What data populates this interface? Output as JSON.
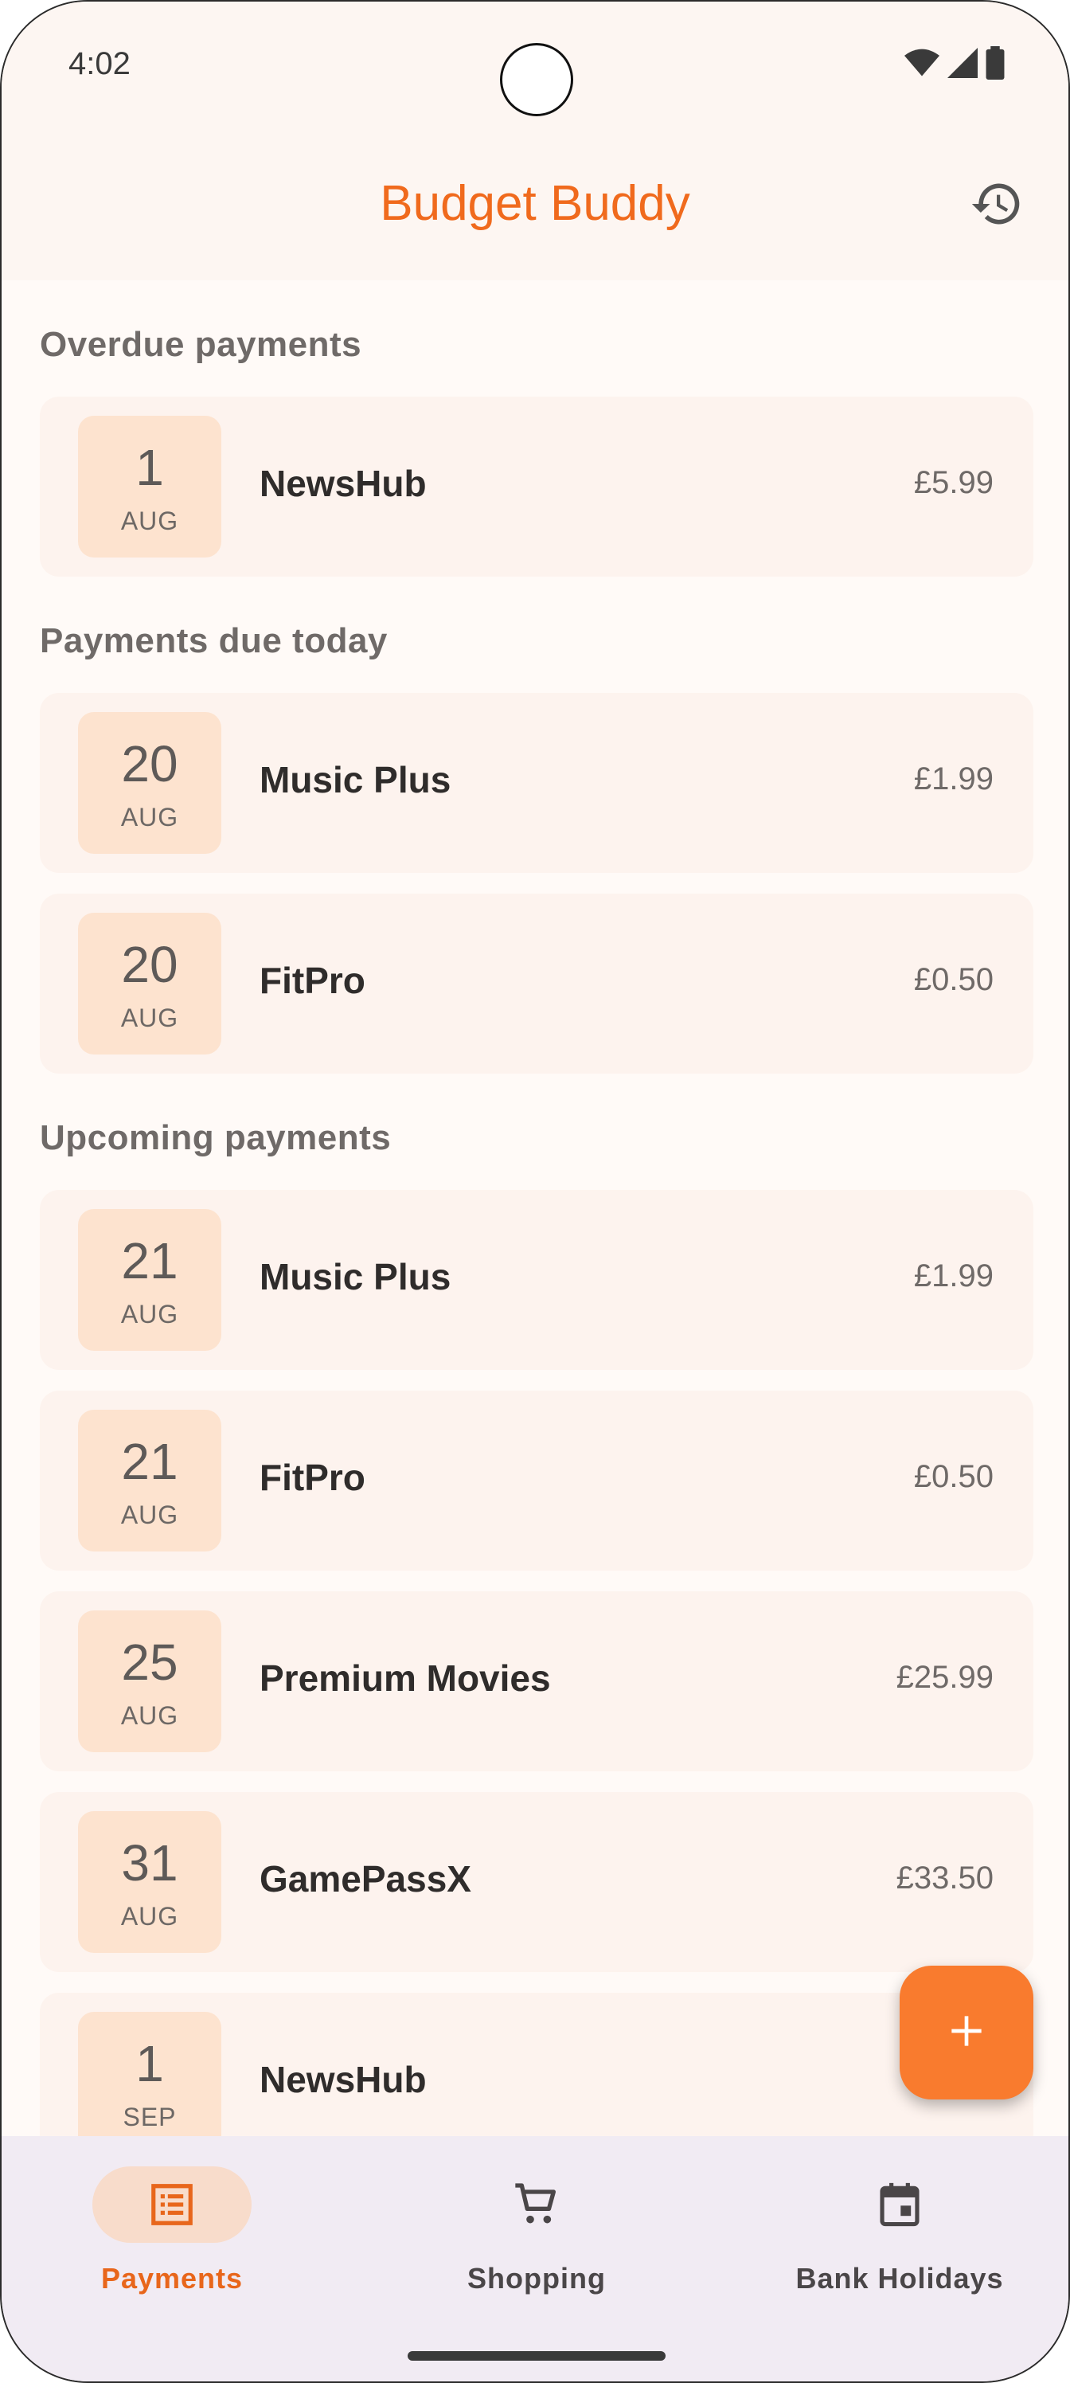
{
  "status_bar": {
    "time": "4:02"
  },
  "app_bar": {
    "title": "Budget Buddy"
  },
  "sections": [
    {
      "title": "Overdue payments",
      "items": [
        {
          "day": "1",
          "month": "AUG",
          "name": "NewsHub",
          "amount": "£5.99"
        }
      ]
    },
    {
      "title": "Payments due today",
      "items": [
        {
          "day": "20",
          "month": "AUG",
          "name": "Music Plus",
          "amount": "£1.99"
        },
        {
          "day": "20",
          "month": "AUG",
          "name": "FitPro",
          "amount": "£0.50"
        }
      ]
    },
    {
      "title": "Upcoming payments",
      "items": [
        {
          "day": "21",
          "month": "AUG",
          "name": "Music Plus",
          "amount": "£1.99"
        },
        {
          "day": "21",
          "month": "AUG",
          "name": "FitPro",
          "amount": "£0.50"
        },
        {
          "day": "25",
          "month": "AUG",
          "name": "Premium Movies",
          "amount": "£25.99"
        },
        {
          "day": "31",
          "month": "AUG",
          "name": "GamePassX",
          "amount": "£33.50"
        },
        {
          "day": "1",
          "month": "SEP",
          "name": "NewsHub",
          "amount": ""
        }
      ]
    }
  ],
  "bottom_nav": {
    "items": [
      {
        "label": "Payments",
        "icon": "list-alt-icon",
        "active": true
      },
      {
        "label": "Shopping",
        "icon": "shopping-cart-icon",
        "active": false
      },
      {
        "label": "Bank Holidays",
        "icon": "calendar-event-icon",
        "active": false
      }
    ]
  },
  "colors": {
    "accent": "#f06a1d",
    "fab": "#f97b2e",
    "card_bg": "#fdf3ee",
    "date_badge_bg": "#fde3cf",
    "nav_bg": "#f1ebf3",
    "nav_active_pill": "#f8dccb"
  }
}
